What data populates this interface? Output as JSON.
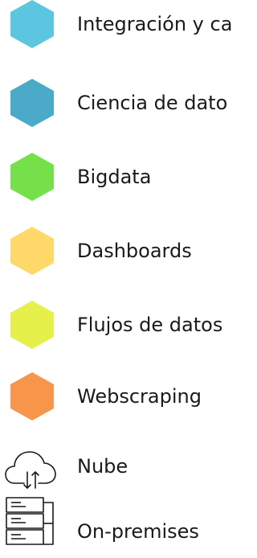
{
  "legend": {
    "items": [
      {
        "label": "Integración y ca",
        "icon": "hexagon-icon",
        "color": "#5cc6e0"
      },
      {
        "label": "Ciencia de dato",
        "icon": "hexagon-icon",
        "color": "#4aaac8"
      },
      {
        "label": "Bigdata",
        "icon": "hexagon-icon",
        "color": "#76e04a"
      },
      {
        "label": "Dashboards",
        "icon": "hexagon-icon",
        "color": "#ffd86a"
      },
      {
        "label": "Flujos de datos",
        "icon": "hexagon-icon",
        "color": "#e6f04a"
      },
      {
        "label": "Webscraping",
        "icon": "hexagon-icon",
        "color": "#f7964a"
      },
      {
        "label": "Nube",
        "icon": "cloud-upload-download-icon",
        "color": "#1a1a1a"
      },
      {
        "label": "On-premises",
        "icon": "server-rack-icon",
        "color": "#1a1a1a"
      }
    ]
  }
}
